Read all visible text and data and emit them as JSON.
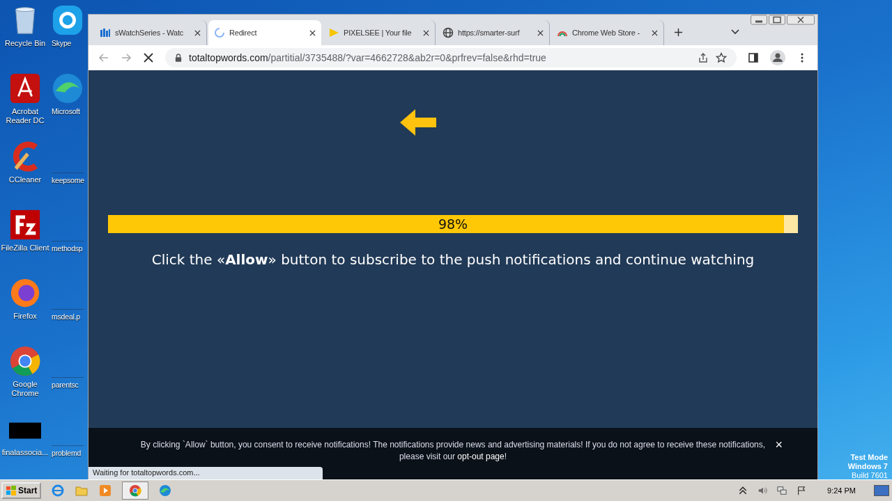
{
  "desktop": {
    "icons": [
      {
        "label": "Recycle Bin",
        "kind": "bin"
      },
      {
        "label": "Skype",
        "kind": "skype"
      },
      {
        "label": "Acrobat Reader DC",
        "kind": "pdf"
      },
      {
        "label": "Microsoft",
        "kind": "edge"
      },
      {
        "label": "CCleaner",
        "kind": "cleaner"
      },
      {
        "label": "keepsome",
        "kind": "blank"
      },
      {
        "label": "FileZilla Client",
        "kind": "filezilla"
      },
      {
        "label": "methodsp",
        "kind": "blank"
      },
      {
        "label": "Firefox",
        "kind": "firefox"
      },
      {
        "label": "msdeal.p",
        "kind": "blank"
      },
      {
        "label": "Google Chrome",
        "kind": "chrome"
      },
      {
        "label": "parentsc",
        "kind": "blank"
      },
      {
        "label": "finalassocia...",
        "kind": "black"
      },
      {
        "label": "problemd",
        "kind": "blank"
      }
    ],
    "watermark_lines": [
      "Test Mode",
      "Windows 7",
      "Build 7601"
    ]
  },
  "browser": {
    "tabs": [
      {
        "title": "sWatchSeries - Watc",
        "selected": false,
        "kind": "bars"
      },
      {
        "title": "Redirect",
        "selected": true,
        "kind": "spinner"
      },
      {
        "title": "PIXELSEE | Your file",
        "selected": false,
        "kind": "play"
      },
      {
        "title": "https://smarter-surf",
        "selected": false,
        "kind": "globe"
      },
      {
        "title": "Chrome Web Store -",
        "selected": false,
        "kind": "rainbow"
      }
    ],
    "url": {
      "host": "totaltopwords.com",
      "path": "/partitial/3735488/?var=4662728&ab2r=0&prfrev=false&rhd=true"
    },
    "status": "Waiting for totaltopwords.com..."
  },
  "page": {
    "progress": {
      "level": 0.98,
      "reading": "98%"
    },
    "message": "Click the «**Allow**» button to subscribe to the push notifications and continue watching",
    "banner": {
      "text": "By clicking `Allow` button, you consent to receive notifications! The notifications provide news and advertising materials! If you do not agree to receive these notifications, please visit our",
      "link": "opt-out page",
      "after": "!",
      "close": "×"
    }
  },
  "taskbar": {
    "start": "Start",
    "clock": "9:24 PM"
  }
}
